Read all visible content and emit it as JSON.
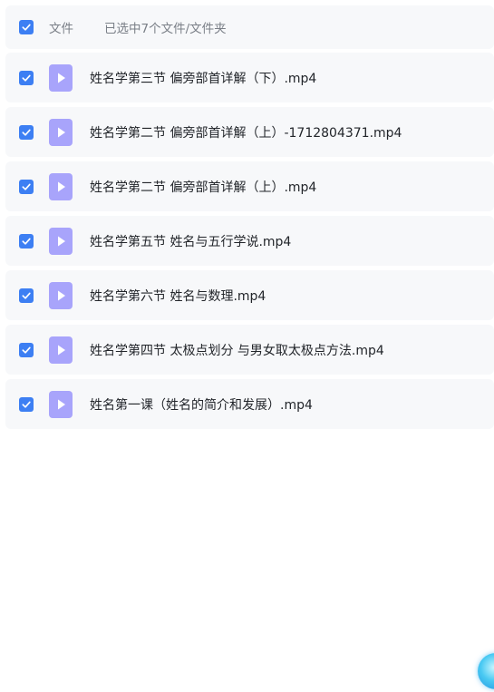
{
  "header": {
    "column_label": "文件",
    "selection_text": "已选中7个文件/文件夹"
  },
  "files": [
    {
      "name": "姓名学第三节 偏旁部首详解（下）.mp4",
      "checked": true,
      "icon": "video-file-icon"
    },
    {
      "name": "姓名学第二节 偏旁部首详解（上）-1712804371.mp4",
      "checked": true,
      "icon": "video-file-icon"
    },
    {
      "name": "姓名学第二节 偏旁部首详解（上）.mp4",
      "checked": true,
      "icon": "video-file-icon"
    },
    {
      "name": "姓名学第五节 姓名与五行学说.mp4",
      "checked": true,
      "icon": "video-file-icon"
    },
    {
      "name": "姓名学第六节 姓名与数理.mp4",
      "checked": true,
      "icon": "video-file-icon"
    },
    {
      "name": "姓名学第四节 太极点划分 与男女取太极点方法.mp4",
      "checked": true,
      "icon": "video-file-icon"
    },
    {
      "name": "姓名第一课（姓名的简介和发展）.mp4",
      "checked": true,
      "icon": "video-file-icon"
    }
  ],
  "colors": {
    "accent": "#3d7ff3",
    "row_background": "#f7f8fa",
    "file_icon": "#a8a4fb"
  }
}
